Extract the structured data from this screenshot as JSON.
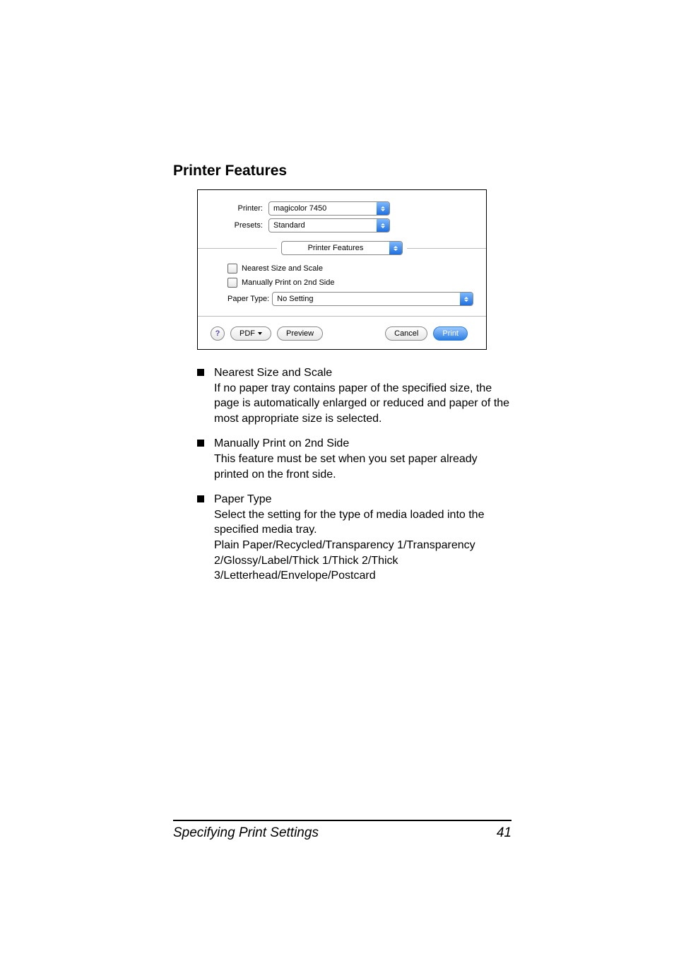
{
  "heading": "Printer Features",
  "dialog": {
    "printerLabel": "Printer:",
    "printerValue": "magicolor 7450",
    "presetsLabel": "Presets:",
    "presetsValue": "Standard",
    "paneValue": "Printer Features",
    "cbNearest": "Nearest Size and Scale",
    "cbManual": "Manually Print on 2nd Side",
    "paperTypeLabel": "Paper Type:",
    "paperTypeValue": "No Setting",
    "help": "?",
    "pdfBtn": "PDF",
    "previewBtn": "Preview",
    "cancelBtn": "Cancel",
    "printBtn": "Print"
  },
  "bullets": [
    {
      "title": "Nearest Size and Scale",
      "body": "If no paper tray contains paper of the specified size, the page is automatically enlarged or reduced and paper of the most appropriate size is selected."
    },
    {
      "title": "Manually Print on 2nd Side",
      "body": "This feature must be set when you set paper already printed on the front side."
    },
    {
      "title": "Paper Type",
      "body": "Select the setting for the type of media loaded into the specified media tray.",
      "body2": "Plain Paper/Recycled/Transparency 1/Transparency 2/Glossy/Label/Thick 1/Thick 2/Thick 3/Letterhead/Envelope/Postcard"
    }
  ],
  "footer": {
    "left": "Specifying Print Settings",
    "right": "41"
  }
}
